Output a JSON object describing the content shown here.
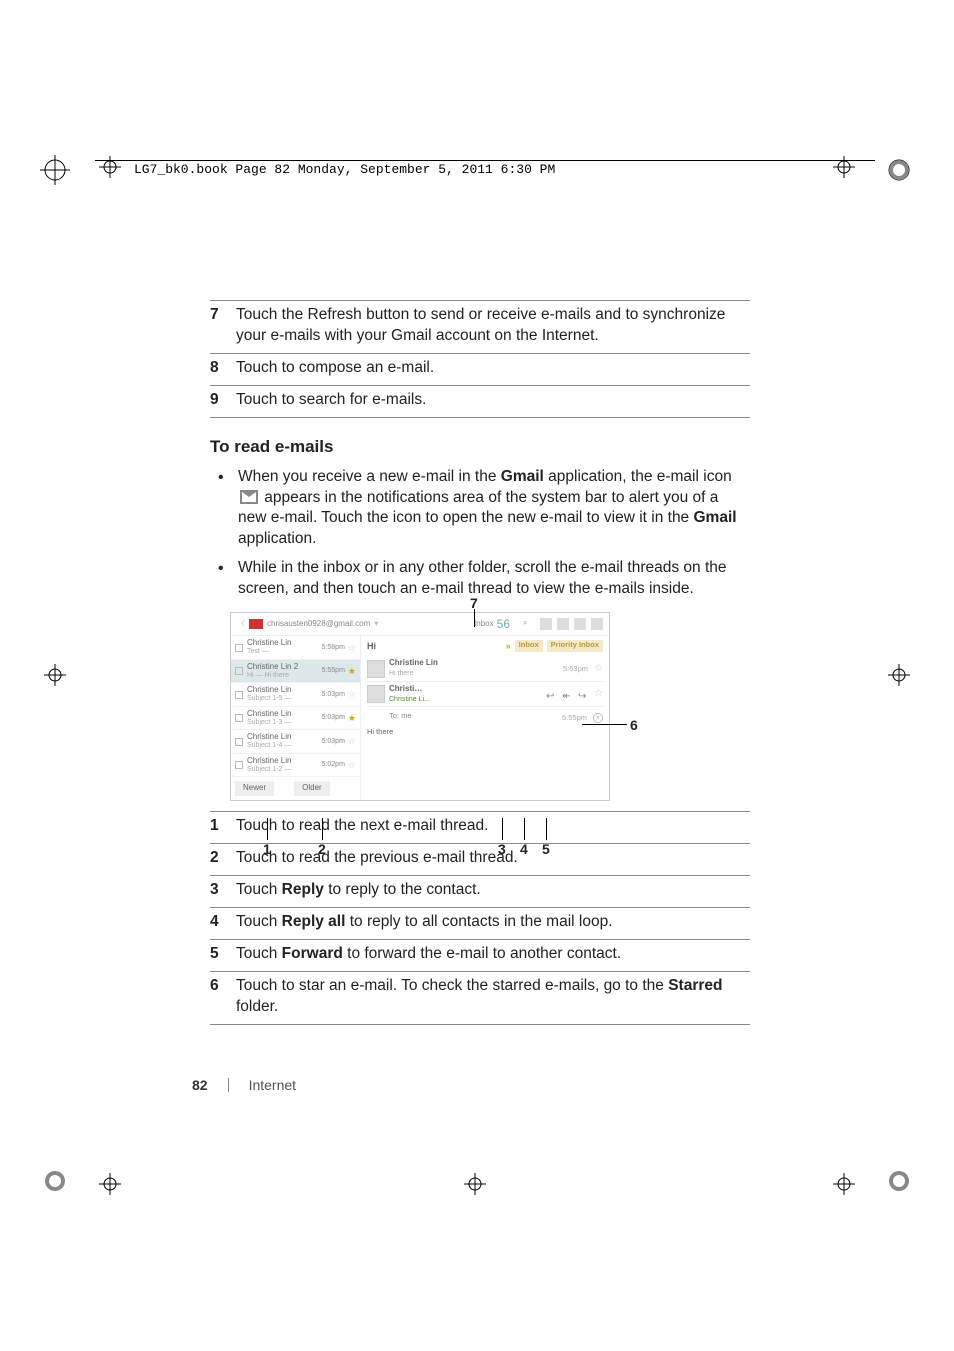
{
  "print_header": "LG7_bk0.book  Page 82  Monday, September 5, 2011   6:30 PM",
  "upper_table": {
    "r7": {
      "num": "7",
      "text": "Touch the Refresh button to send or receive e-mails and to synchronize your e-mails with your Gmail account on the Internet."
    },
    "r8": {
      "num": "8",
      "text": "Touch to compose an e-mail."
    },
    "r9": {
      "num": "9",
      "text": "Touch to search for e-mails."
    }
  },
  "section_title": "To read e-mails",
  "bullets": {
    "b1_part1": "When you receive a new e-mail in the ",
    "b1_gmail": "Gmail",
    "b1_part2": " application, the e-mail icon ",
    "b1_part3": " appears in the notifications area of the system bar to alert you of a new e-mail. Touch the icon to open the new e-mail to view it in the ",
    "b1_gmail2": "Gmail",
    "b1_part4": " application.",
    "b2": "While in the inbox or in any other folder, scroll the e-mail threads on the screen, and then touch an e-mail thread to view the e-mails inside."
  },
  "screenshot": {
    "account": "chrisausten0928@gmail.com",
    "inbox_label": "Inbox",
    "inbox_count": "56",
    "subj": "Hi",
    "tag_inbox": "Inbox",
    "tag_priority": "Priority Inbox",
    "rows": [
      {
        "from": "Christine Lin",
        "sub": "Test —",
        "time": "5:58pm"
      },
      {
        "from": "Christine Lin  2",
        "sub": "Hi — Hi there",
        "time": "5:55pm"
      },
      {
        "from": "Christine Lin",
        "sub": "Subject 1-5 —",
        "time": "5:03pm"
      },
      {
        "from": "Christine Lin",
        "sub": "Subject 1-3 —",
        "time": "5:03pm"
      },
      {
        "from": "Christine Lin",
        "sub": "Subject 1-4 —",
        "time": "5:03pm"
      },
      {
        "from": "Christine Lin",
        "sub": "Subject 1-2 —",
        "time": "5:02pm"
      }
    ],
    "newer": "Newer",
    "older": "Older",
    "msg1": {
      "from": "Christine Lin",
      "preview": "Hi there",
      "time": "5:53pm"
    },
    "msg2": {
      "from": "Christi…",
      "preview": "Christine Li...",
      "time": "5:55pm"
    },
    "to": "To: me",
    "bodytext": "Hi there"
  },
  "callouts": {
    "c1": "1",
    "c2": "2",
    "c3": "3",
    "c4": "4",
    "c5": "5",
    "c6": "6",
    "c7": "7"
  },
  "lower_table": {
    "r1": {
      "num": "1",
      "text": "Touch to read the next e-mail thread."
    },
    "r2": {
      "num": "2",
      "text": "Touch to read the previous e-mail thread."
    },
    "r3": {
      "num": "3",
      "pre": "Touch ",
      "bold": "Reply",
      "post": " to reply to the contact."
    },
    "r4": {
      "num": "4",
      "pre": "Touch ",
      "bold": "Reply all",
      "post": " to reply to all contacts in the mail loop."
    },
    "r5": {
      "num": "5",
      "pre": "Touch ",
      "bold": "Forward",
      "post": " to forward the e-mail to another contact."
    },
    "r6": {
      "num": "6",
      "pre": "Touch to star an e-mail. To check the starred e-mails, go to the ",
      "bold": "Starred",
      "post": " folder."
    }
  },
  "footer": {
    "page": "82",
    "section": "Internet"
  }
}
